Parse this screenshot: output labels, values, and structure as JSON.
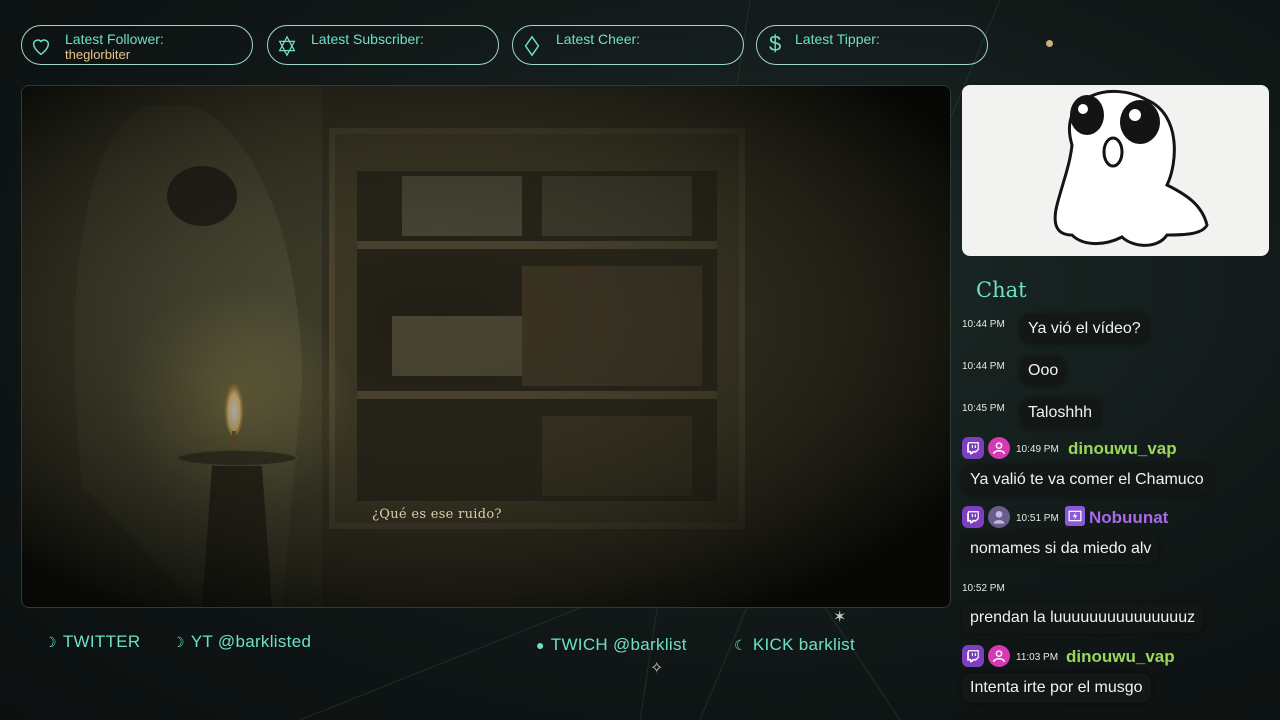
{
  "alerts": [
    {
      "icon": "heart-icon",
      "label": "Latest Follower:",
      "value": "theglorbiter"
    },
    {
      "icon": "hexagram-icon",
      "label": "Latest Subscriber:",
      "value": ""
    },
    {
      "icon": "diamond-icon",
      "label": "Latest Cheer:",
      "value": ""
    },
    {
      "icon": "dollar-icon",
      "label": "Latest Tipper:",
      "value": ""
    }
  ],
  "game": {
    "subtitle": "¿Qué es ese ruido?"
  },
  "chat": {
    "title": "Chat",
    "messages": [
      {
        "time": "10:44 PM",
        "text": "Ya vió el vídeo?"
      },
      {
        "time": "10:44 PM",
        "text": "Ooo"
      },
      {
        "time": "10:45 PM",
        "text": "Taloshhh"
      },
      {
        "time": "10:49 PM",
        "user": "dinouwu_vap",
        "text": "Ya valió te va comer el Chamuco"
      },
      {
        "time": "10:51 PM",
        "user": "Nobuunat",
        "text": "nomames si da miedo alv"
      },
      {
        "time": "10:52 PM",
        "text": "prendan la luuuuuuuuuuuuuuuz"
      },
      {
        "time": "11:03 PM",
        "user": "dinouwu_vap",
        "text": "Intenta irte por el musgo"
      }
    ]
  },
  "socials": [
    {
      "icon": "moon-icon",
      "label": "TWITTER"
    },
    {
      "icon": "moon-icon",
      "label": "YT @barklisted"
    },
    {
      "icon": "circle-icon",
      "label": "TWICH @barklist"
    },
    {
      "icon": "moon-icon",
      "label": "KICK barklist"
    }
  ],
  "colors": {
    "accent": "#6ee0c8",
    "gold": "#e9c58a",
    "green_user": "#9bd65a",
    "purple_user": "#a86ae6"
  }
}
